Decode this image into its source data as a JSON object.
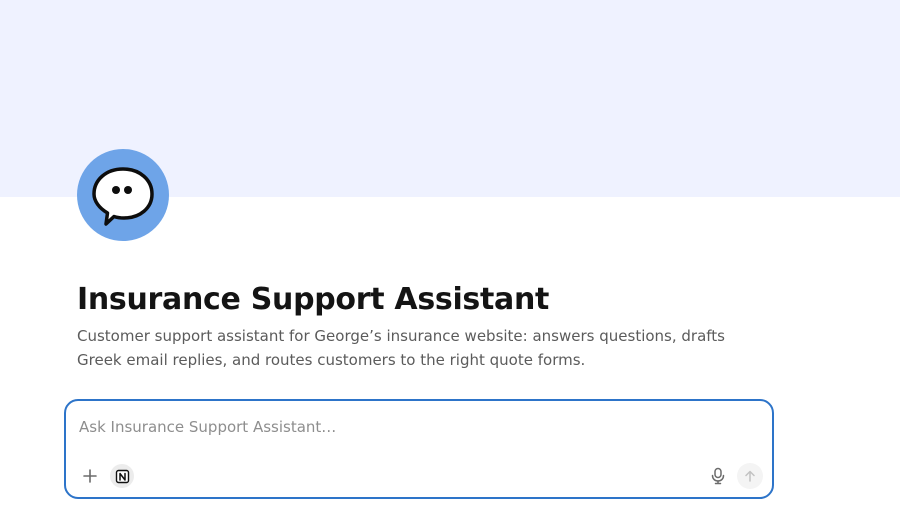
{
  "page": {
    "title": "Insurance Support Assistant",
    "description": "Customer support assistant for George’s insurance website: answers questions, drafts Greek email replies, and routes customers to the right quote forms."
  },
  "avatar": {
    "icon": "speech-bubble-icon",
    "color": "#6ea4e8"
  },
  "composer": {
    "placeholder": "Ask Insurance Support Assistant…",
    "value": "",
    "tools": [
      {
        "name": "add",
        "icon": "plus-icon"
      },
      {
        "name": "notion",
        "icon": "notion-icon"
      },
      {
        "name": "voice",
        "icon": "microphone-icon"
      },
      {
        "name": "send",
        "icon": "arrow-up-icon"
      }
    ]
  },
  "colors": {
    "cover": "#eff2ff",
    "accent": "#2d74c9",
    "title": "#141414",
    "description": "#5b5b5b"
  }
}
